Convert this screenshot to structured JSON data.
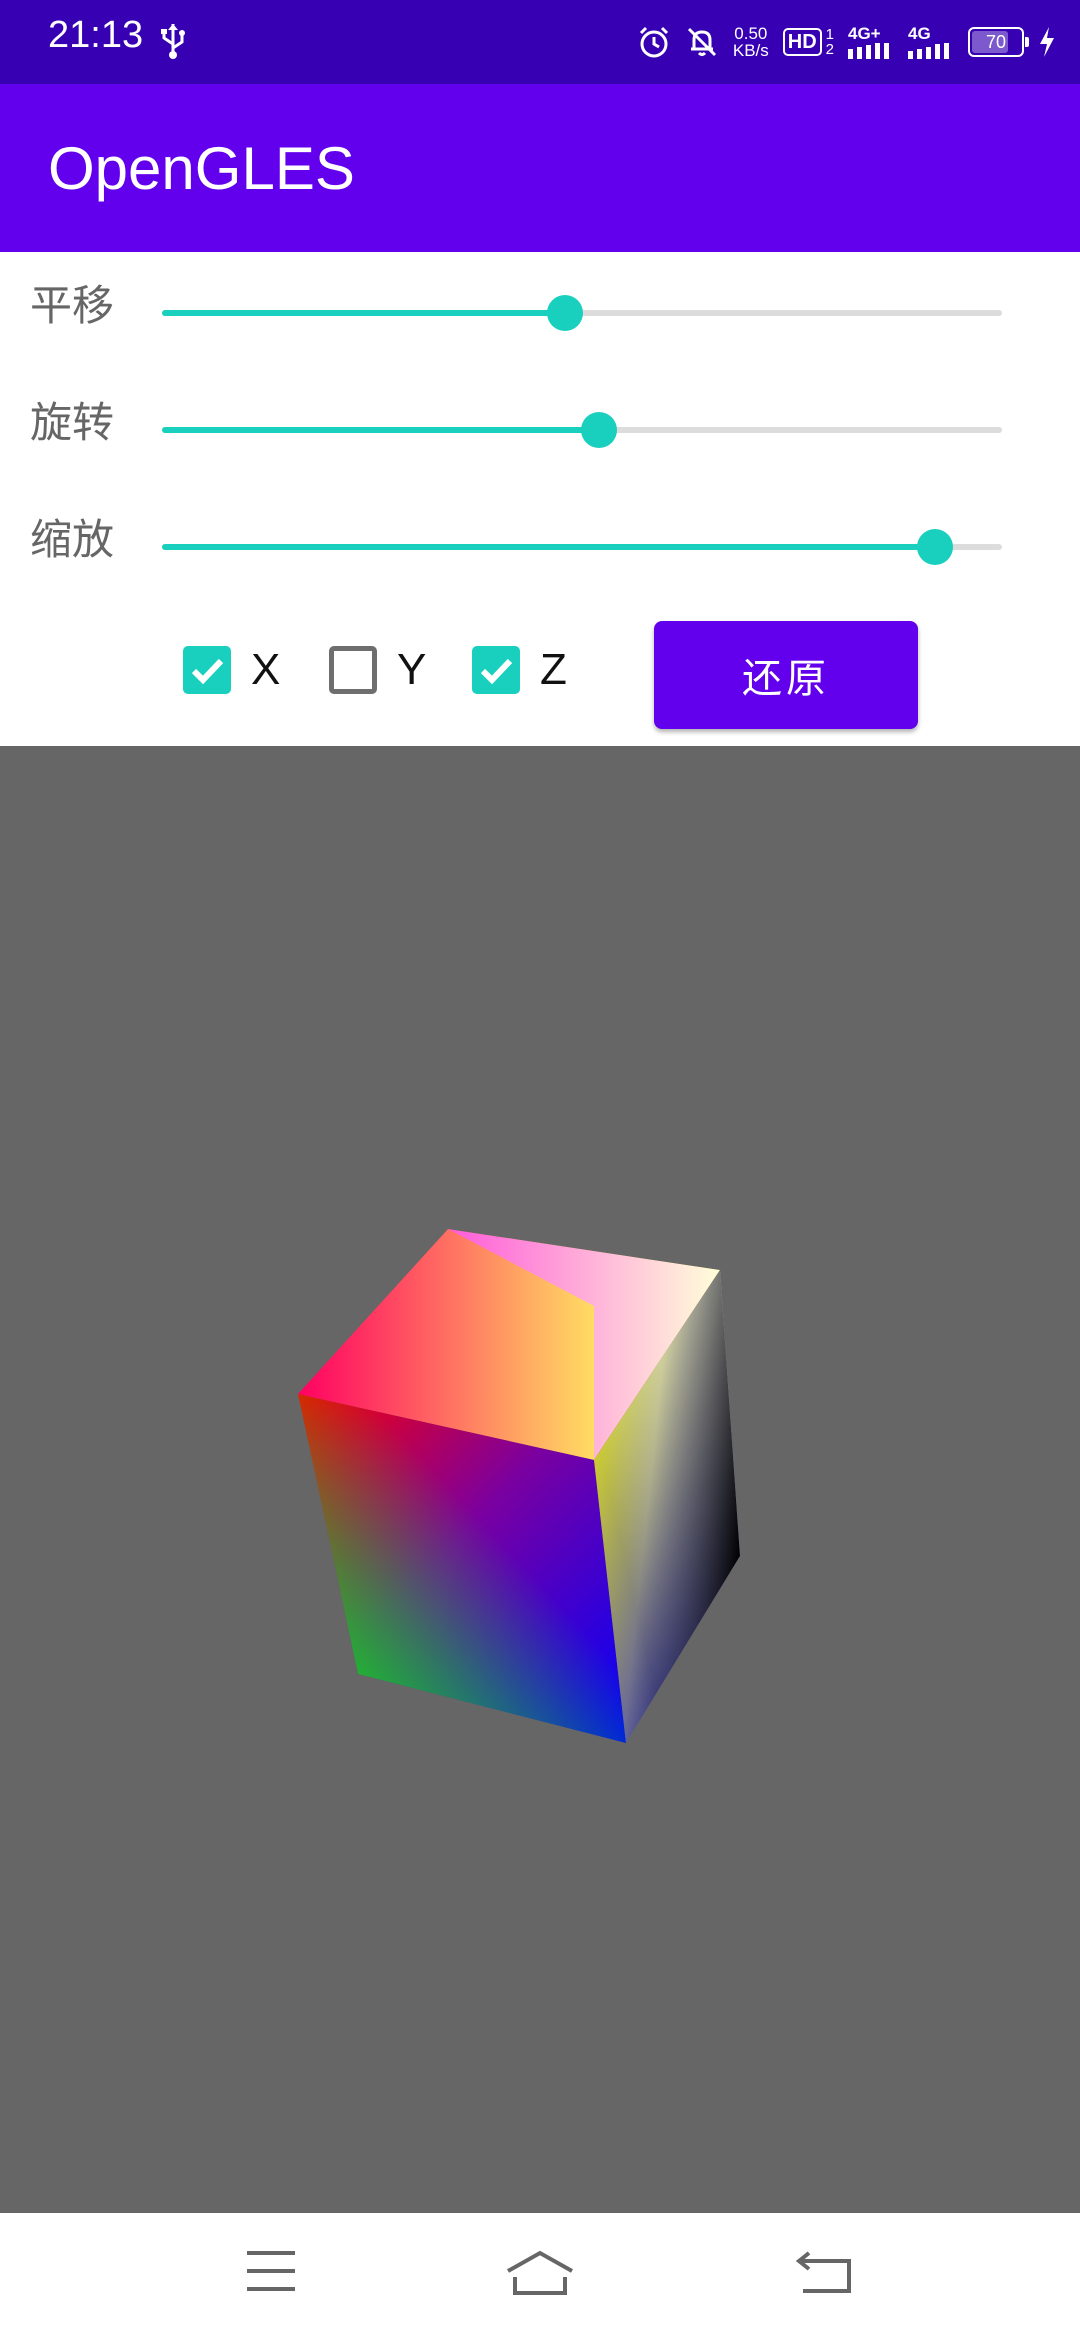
{
  "status_bar": {
    "time": "21:13",
    "net_speed_value": "0.50",
    "net_speed_unit": "KB/s",
    "hd_label": "HD",
    "sim_sub_1": "1",
    "sim_sub_2": "2",
    "network1": "4G+",
    "network2": "4G",
    "battery_level": "70",
    "icons": [
      "usb-icon",
      "alarm-icon",
      "mute-icon",
      "signal-icon",
      "battery-icon",
      "charging-icon"
    ]
  },
  "app_bar": {
    "title": "OpenGLES"
  },
  "controls": {
    "sliders": [
      {
        "label": "平移",
        "value": 0.48
      },
      {
        "label": "旋转",
        "value": 0.52
      },
      {
        "label": "缩放",
        "value": 0.92
      }
    ],
    "checkboxes": [
      {
        "label": "X",
        "checked": true
      },
      {
        "label": "Y",
        "checked": false
      },
      {
        "label": "Z",
        "checked": true
      }
    ],
    "reset_label": "还原"
  },
  "colors": {
    "accent": "#18d0bd",
    "primary": "#6200ee",
    "primary_dark": "#3700b3",
    "gl_background": "#666666"
  },
  "nav_bar": {
    "icons": [
      "menu-icon",
      "home-icon",
      "back-icon"
    ]
  }
}
